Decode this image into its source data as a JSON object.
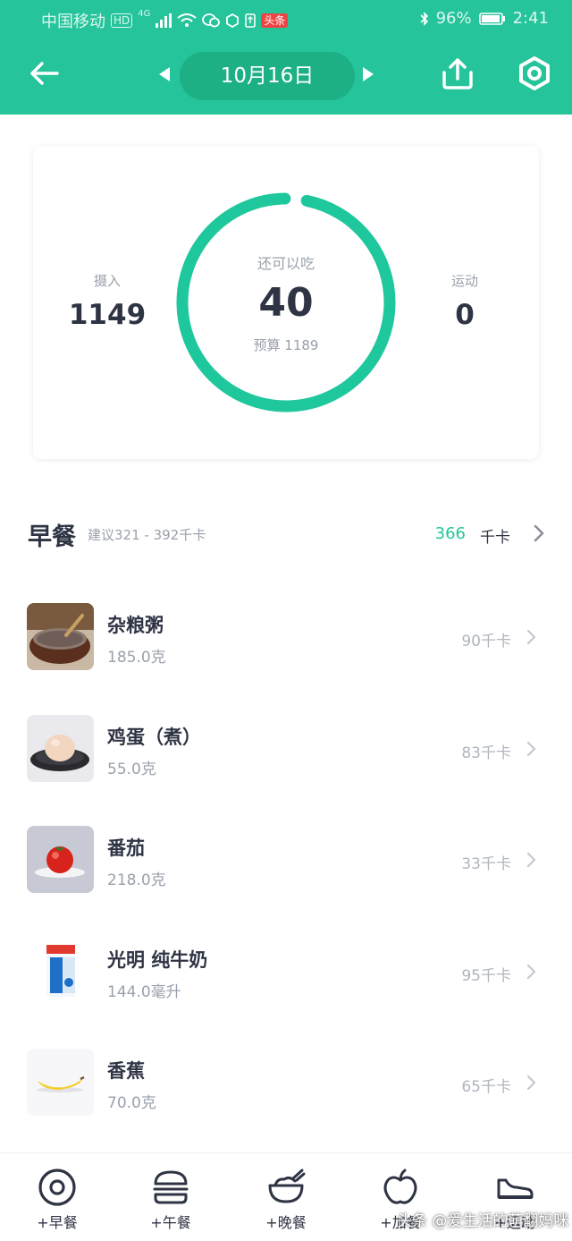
{
  "status_bar": {
    "carrier": "中国移动",
    "network": "4G",
    "badge_hd": "HD",
    "badge_app": "头条",
    "battery": "96%",
    "time": "2:41"
  },
  "header": {
    "date": "10月16日",
    "background_color": "#25c49a"
  },
  "summary": {
    "intake_label": "摄入",
    "intake_value": "1149",
    "remaining_label": "还可以吃",
    "remaining_value": "40",
    "budget_text": "预算 1189",
    "exercise_label": "运动",
    "exercise_value": "0",
    "ring_progress_fraction": 0.966,
    "ring_color": "#1fc79c"
  },
  "breakfast": {
    "title": "早餐",
    "suggestion": "建议321 - 392千卡",
    "kcal_total": "366",
    "kcal_unit": "千卡",
    "items": [
      {
        "name": "杂粮粥",
        "amount": "185.0克",
        "kcal": "90千卡",
        "icon": "porridge-bowl"
      },
      {
        "name": "鸡蛋（煮）",
        "amount": "55.0克",
        "kcal": "83千卡",
        "icon": "boiled-egg"
      },
      {
        "name": "番茄",
        "amount": "218.0克",
        "kcal": "33千卡",
        "icon": "tomato"
      },
      {
        "name": "光明 纯牛奶",
        "amount": "144.0毫升",
        "kcal": "95千卡",
        "icon": "milk-carton"
      },
      {
        "name": "香蕉",
        "amount": "70.0克",
        "kcal": "65千卡",
        "icon": "banana"
      }
    ]
  },
  "tabs": [
    {
      "label": "+早餐",
      "icon": "egg-icon"
    },
    {
      "label": "+午餐",
      "icon": "burger-icon"
    },
    {
      "label": "+晚餐",
      "icon": "rice-bowl-icon"
    },
    {
      "label": "+加餐",
      "icon": "apple-icon"
    },
    {
      "label": "+运动",
      "icon": "shoe-icon"
    }
  ],
  "watermark": "头条 @爱生活的萌翻妈咪"
}
